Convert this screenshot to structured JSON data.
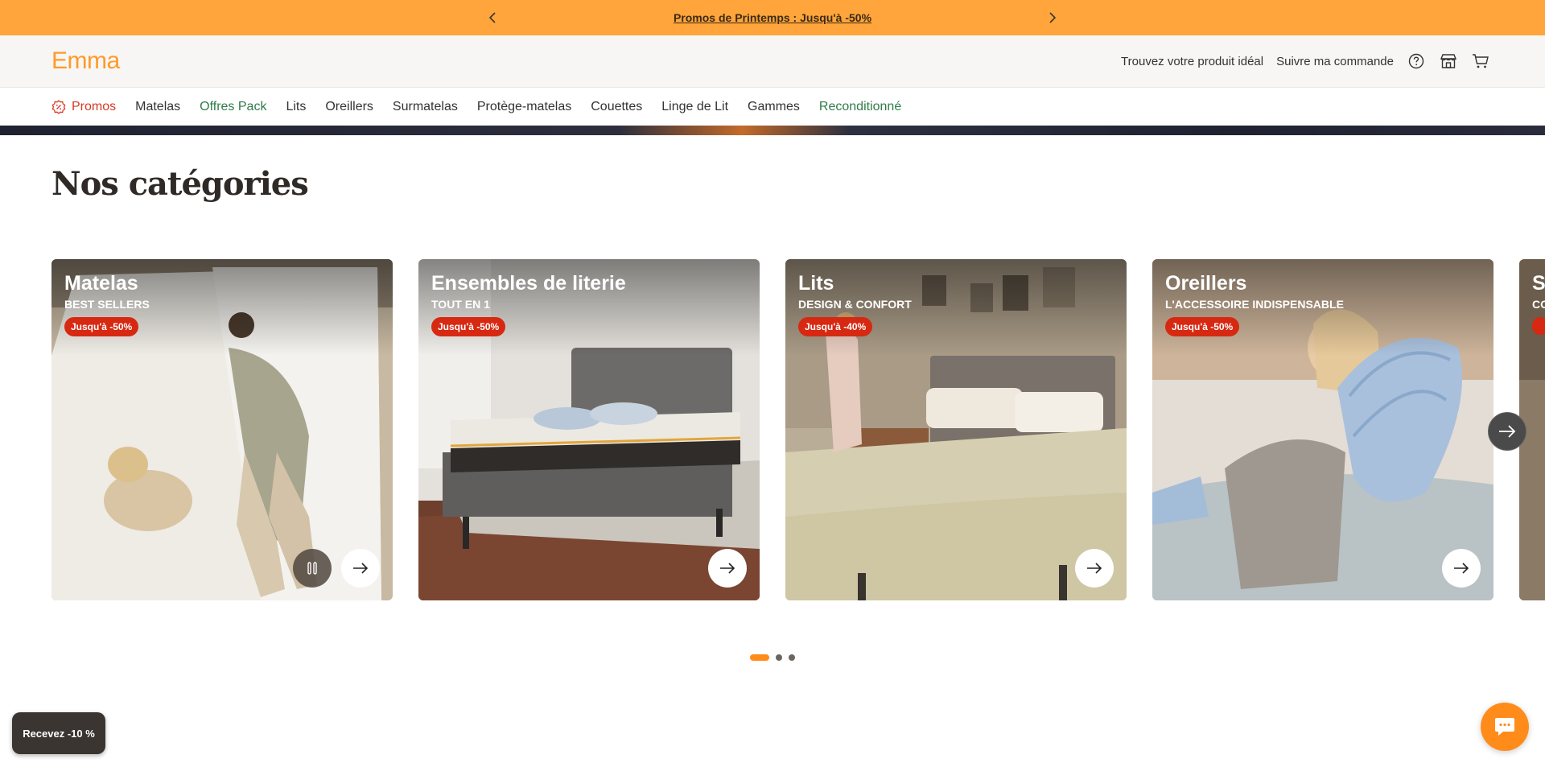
{
  "promo_bar": {
    "text": "Promos de Printemps : Jusqu'à -50%",
    "prev_icon": "chevron-left-icon",
    "next_icon": "chevron-right-icon",
    "color": "#ffa53b"
  },
  "header": {
    "logo": "Emma",
    "links": {
      "find_product": "Trouvez votre produit idéal",
      "track_order": "Suivre ma commande"
    },
    "icons": [
      "help-icon",
      "store-icon",
      "cart-icon"
    ]
  },
  "nav": {
    "items": [
      {
        "label": "Promos"
      },
      {
        "label": "Matelas"
      },
      {
        "label": "Offres Pack"
      },
      {
        "label": "Lits"
      },
      {
        "label": "Oreillers"
      },
      {
        "label": "Surmatelas"
      },
      {
        "label": "Protège-matelas"
      },
      {
        "label": "Couettes"
      },
      {
        "label": "Linge de Lit"
      },
      {
        "label": "Gammes"
      },
      {
        "label": "Reconditionné"
      }
    ]
  },
  "categories": {
    "title": "Nos catégories",
    "cards": [
      {
        "title": "Matelas",
        "subtitle": "BEST SELLERS",
        "badge": "Jusqu'à -50%"
      },
      {
        "title": "Ensembles de literie",
        "subtitle": "TOUT EN 1",
        "badge": "Jusqu'à -50%"
      },
      {
        "title": "Lits",
        "subtitle": "DESIGN & CONFORT",
        "badge": "Jusqu'à -40%"
      },
      {
        "title": "Oreillers",
        "subtitle": "L'ACCESSOIRE INDISPENSABLE",
        "badge": "Jusqu'à -50%"
      },
      {
        "title": "S",
        "subtitle": "CO",
        "badge": ""
      }
    ],
    "pagination": {
      "total": 3,
      "active": 1
    }
  },
  "widgets": {
    "discount_label": "Recevez -10 %",
    "chat_icon": "chat-icon"
  },
  "colors": {
    "accent": "#ff8c1a",
    "promo_red": "#d72812",
    "nav_green": "#2f7b4a"
  }
}
